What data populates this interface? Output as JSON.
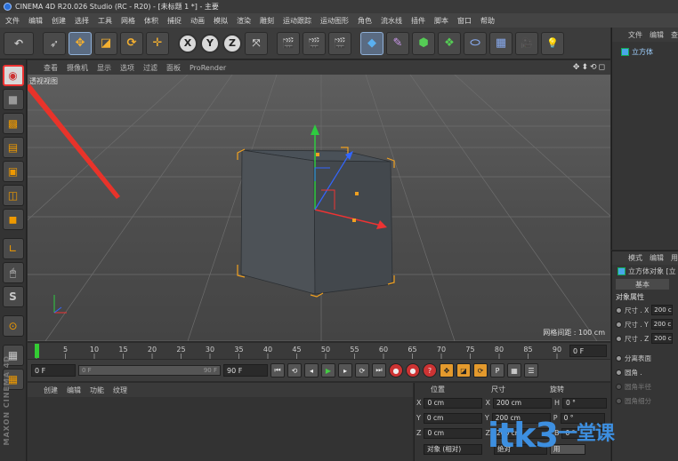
{
  "window": {
    "title": "CINEMA 4D R20.026 Studio (RC - R20) - [未标题 1 *] - 主要"
  },
  "menu": [
    "文件",
    "编辑",
    "创建",
    "选择",
    "工具",
    "网格",
    "体积",
    "捕捉",
    "动画",
    "模拟",
    "渲染",
    "雕刻",
    "运动跟踪",
    "运动图形",
    "角色",
    "流水线",
    "插件",
    "脚本",
    "窗口",
    "帮助"
  ],
  "toolbar": {
    "axis_x": "X",
    "axis_y": "Y",
    "axis_z": "Z"
  },
  "viewport": {
    "menu": [
      "查看",
      "摄像机",
      "显示",
      "选项",
      "过滤",
      "面板",
      "ProRender"
    ],
    "label": "透视视图",
    "grid_info": "网格间距 : 100 cm",
    "nav_icons": "✥⬍⟲◻"
  },
  "timeline": {
    "ticks": [
      "0",
      "5",
      "10",
      "15",
      "20",
      "25",
      "30",
      "35",
      "40",
      "45",
      "50",
      "55",
      "60",
      "65",
      "70",
      "75",
      "80",
      "85",
      "90"
    ],
    "end_frame_field": "0 F",
    "current_frame": 0,
    "max_frame": 90
  },
  "playback": {
    "start": "0 F",
    "slider_left": "0 F",
    "slider_right": "90 F",
    "end": "90 F"
  },
  "materials": {
    "menu": [
      "创建",
      "编辑",
      "功能",
      "纹理"
    ]
  },
  "coords": {
    "headers": [
      "位置",
      "尺寸",
      "旋转"
    ],
    "rows": [
      {
        "axis": "X",
        "pos": "0 cm",
        "saxis": "X",
        "size": "200 cm",
        "raxis": "H",
        "rot": "0 °"
      },
      {
        "axis": "Y",
        "pos": "0 cm",
        "saxis": "Y",
        "size": "200 cm",
        "raxis": "P",
        "rot": "0 °"
      },
      {
        "axis": "Z",
        "pos": "0 cm",
        "saxis": "Z",
        "size": "200 cm",
        "raxis": "B",
        "rot": "0 °"
      }
    ],
    "mode": "对象 (相对)",
    "size_mode": "绝对",
    "apply": "用"
  },
  "object_manager": {
    "menu": [
      "文件",
      "编辑",
      "查"
    ],
    "object": "立方体"
  },
  "attributes": {
    "menu": [
      "模式",
      "编辑",
      "用"
    ],
    "title": "立方体对象 [立",
    "tab": "基本",
    "section": "对象属性",
    "rows": [
      {
        "label": "尺寸 . X",
        "value": "200 c"
      },
      {
        "label": "尺寸 . Y",
        "value": "200 c"
      },
      {
        "label": "尺寸 . Z",
        "value": "200 c"
      }
    ],
    "extra": [
      "分离表面",
      "圆角 .",
      "圆角半径",
      "圆角细分"
    ]
  },
  "watermark": {
    "text": "itk3",
    "cn": "一堂课"
  },
  "branding": "MAXON CINEMA 4D",
  "colors": {
    "accent": "#3d8fe0",
    "axis_x": "#e33",
    "axis_y": "#3c3",
    "axis_z": "#36f",
    "selection": "#f0a020"
  }
}
